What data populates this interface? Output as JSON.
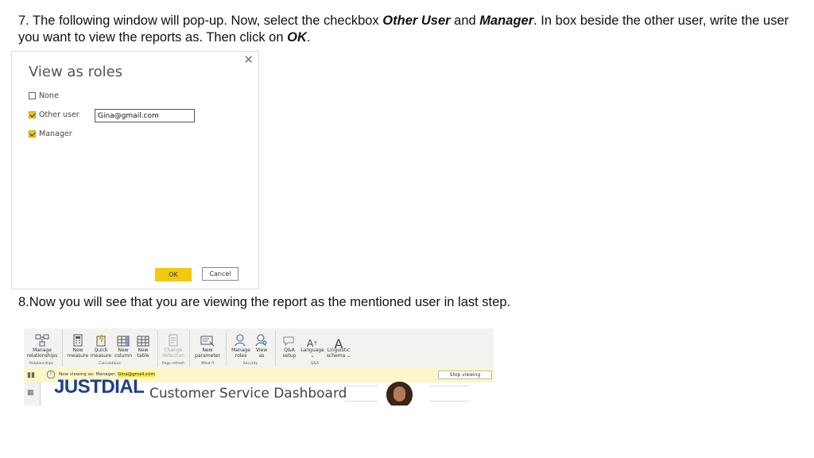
{
  "step7": {
    "part1": "7. The following window will pop-up. Now, select the checkbox ",
    "bold1": "Other User",
    "part2": " and ",
    "bold2": "Manager",
    "part3": ". In box beside the other user, write the user you want to view the reports as. Then click on ",
    "bold3": "OK",
    "part4": "."
  },
  "dialog": {
    "title": "View as roles",
    "close": "✕",
    "options": [
      {
        "label": "None",
        "checked": false
      },
      {
        "label": "Other user",
        "checked": true
      },
      {
        "label": "Manager",
        "checked": true
      }
    ],
    "user_value": "Gina@gmail.com",
    "ok_label": "OK",
    "cancel_label": "Cancel"
  },
  "step8": "8.Now you will see that you are viewing the report as the mentioned user in last step.",
  "ribbon": {
    "buttons": [
      {
        "line1": "Manage",
        "line2": "relationships"
      },
      {
        "line1": "New",
        "line2": "measure"
      },
      {
        "line1": "Quick",
        "line2": "measure"
      },
      {
        "line1": "New",
        "line2": "column"
      },
      {
        "line1": "New",
        "line2": "table"
      },
      {
        "line1": "Change",
        "line2": "detection"
      },
      {
        "line1": "New",
        "line2": "parameter"
      },
      {
        "line1": "Manage",
        "line2": "roles"
      },
      {
        "line1": "View",
        "line2": "as"
      },
      {
        "line1": "Q&A",
        "line2": "setup"
      },
      {
        "line1": "Language",
        "line2": "⌄"
      },
      {
        "line1": "Linguistic",
        "line2": "schema ⌄"
      }
    ],
    "groups": [
      "Relationships",
      "Calculations",
      "Page refresh",
      "What if",
      "Security",
      "Q&A"
    ]
  },
  "banner": {
    "prefix": "Now viewing as: Manager, ",
    "user": "Gina@gmail.com",
    "stop_label": "Stop viewing"
  },
  "report": {
    "logo": "JUSTDIAL",
    "title": "Customer Service Dashboard"
  }
}
